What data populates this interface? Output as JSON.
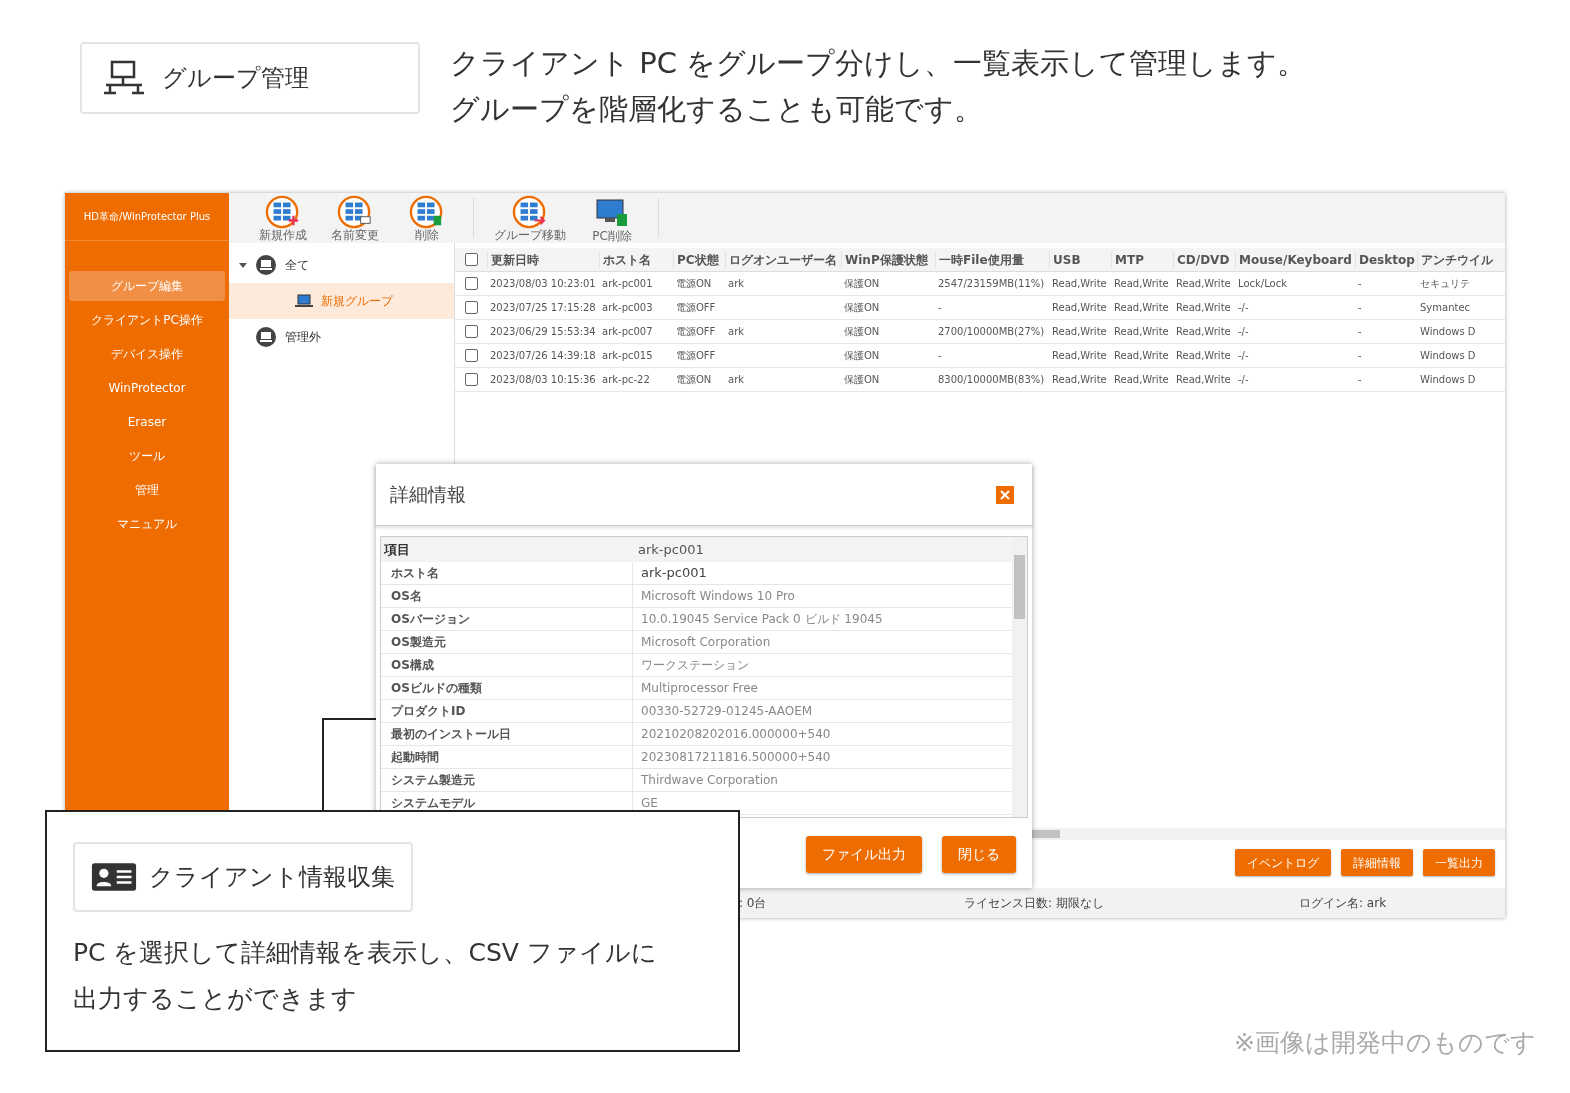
{
  "feature": {
    "title": "グループ管理",
    "description": [
      "クライアント PC をグループ分けし、一覧表示して管理します。",
      "グループを階層化することも可能です。"
    ]
  },
  "app": {
    "title": "HD革命/WinProtector Plus",
    "sidebar": [
      {
        "label": "グループ編集",
        "selected": true
      },
      {
        "label": "クライアントPC操作",
        "selected": false
      },
      {
        "label": "デバイス操作",
        "selected": false
      },
      {
        "label": "WinProtector",
        "selected": false
      },
      {
        "label": "Eraser",
        "selected": false
      },
      {
        "label": "ツール",
        "selected": false
      },
      {
        "label": "管理",
        "selected": false
      },
      {
        "label": "マニュアル",
        "selected": false
      }
    ],
    "toolbar": [
      {
        "label": "新規作成"
      },
      {
        "label": "名前変更"
      },
      {
        "label": "削除"
      },
      {
        "label": "グループ移動"
      },
      {
        "label": "PC削除"
      }
    ],
    "tree": [
      {
        "label": "全て",
        "expanded": true,
        "selected": false,
        "children": [
          {
            "label": "新規グループ",
            "selected": true
          }
        ]
      },
      {
        "label": "管理外",
        "selected": false
      }
    ],
    "table": {
      "all_checked": false,
      "columns": [
        "更新日時",
        "ホスト名",
        "PC状態",
        "ログオンユーザー名",
        "WinP保護状態",
        "一時File使用量",
        "USB",
        "MTP",
        "CD/DVD",
        "Mouse/Keyboard",
        "Desktop",
        "アンチウイル"
      ],
      "rows": [
        {
          "checked": false,
          "cells": [
            "2023/08/03 10:23:01",
            "ark-pc001",
            "電源ON",
            "ark",
            "保護ON",
            "2547/23159MB(11%)",
            "Read,Write",
            "Read,Write",
            "Read,Write",
            "Lock/Lock",
            "-",
            "セキュリテ"
          ]
        },
        {
          "checked": false,
          "cells": [
            "2023/07/25 17:15:28",
            "ark-pc003",
            "電源OFF",
            "",
            "保護ON",
            "-",
            "Read,Write",
            "Read,Write",
            "Read,Write",
            "-/-",
            "-",
            "Symantec"
          ]
        },
        {
          "checked": false,
          "cells": [
            "2023/06/29 15:53:34",
            "ark-pc007",
            "電源OFF",
            "ark",
            "保護ON",
            "2700/10000MB(27%)",
            "Read,Write",
            "Read,Write",
            "Read,Write",
            "-/-",
            "-",
            "Windows D"
          ]
        },
        {
          "checked": false,
          "cells": [
            "2023/07/26 14:39:18",
            "ark-pc015",
            "電源OFF",
            "",
            "保護ON",
            "-",
            "Read,Write",
            "Read,Write",
            "Read,Write",
            "-/-",
            "-",
            "Windows D"
          ]
        },
        {
          "checked": false,
          "cells": [
            "2023/08/03 10:15:36",
            "ark-pc-22",
            "電源ON",
            "ark",
            "保護ON",
            "8300/10000MB(83%)",
            "Read,Write",
            "Read,Write",
            "Read,Write",
            "-/-",
            "-",
            "Windows D"
          ]
        }
      ]
    },
    "buttons": [
      "イベントログ",
      "詳細情報",
      "一覧出力"
    ],
    "status_bar": [
      ": 0台",
      "ライセンス日数: 期限なし",
      "ログイン名: ark"
    ]
  },
  "dialog": {
    "title": "詳細情報",
    "header": [
      "項目",
      "ark-pc001"
    ],
    "rows": [
      [
        "ホスト名",
        "ark-pc001"
      ],
      [
        "OS名",
        "Microsoft Windows 10 Pro"
      ],
      [
        "OSバージョン",
        "10.0.19045 Service Pack 0 ビルド 19045"
      ],
      [
        "OS製造元",
        "Microsoft Corporation"
      ],
      [
        "OS構成",
        "ワークステーション"
      ],
      [
        "OSビルドの種類",
        "Multiprocessor Free"
      ],
      [
        "プロダクトID",
        "00330-52729-01245-AAOEM"
      ],
      [
        "最初のインストール日",
        "20210208202016.000000+540"
      ],
      [
        "起動時間",
        "20230817211816.500000+540"
      ],
      [
        "システム製造元",
        "Thirdwave Corporation"
      ],
      [
        "システムモデル",
        "GE"
      ]
    ],
    "buttons": [
      "ファイル出力",
      "閉じる"
    ]
  },
  "callout": {
    "title": "クライアント情報収集",
    "description": [
      "PC を選択して詳細情報を表示し、CSV ファイルに",
      "出力することができます"
    ]
  },
  "footnote": "※画像は開発中のものです"
}
